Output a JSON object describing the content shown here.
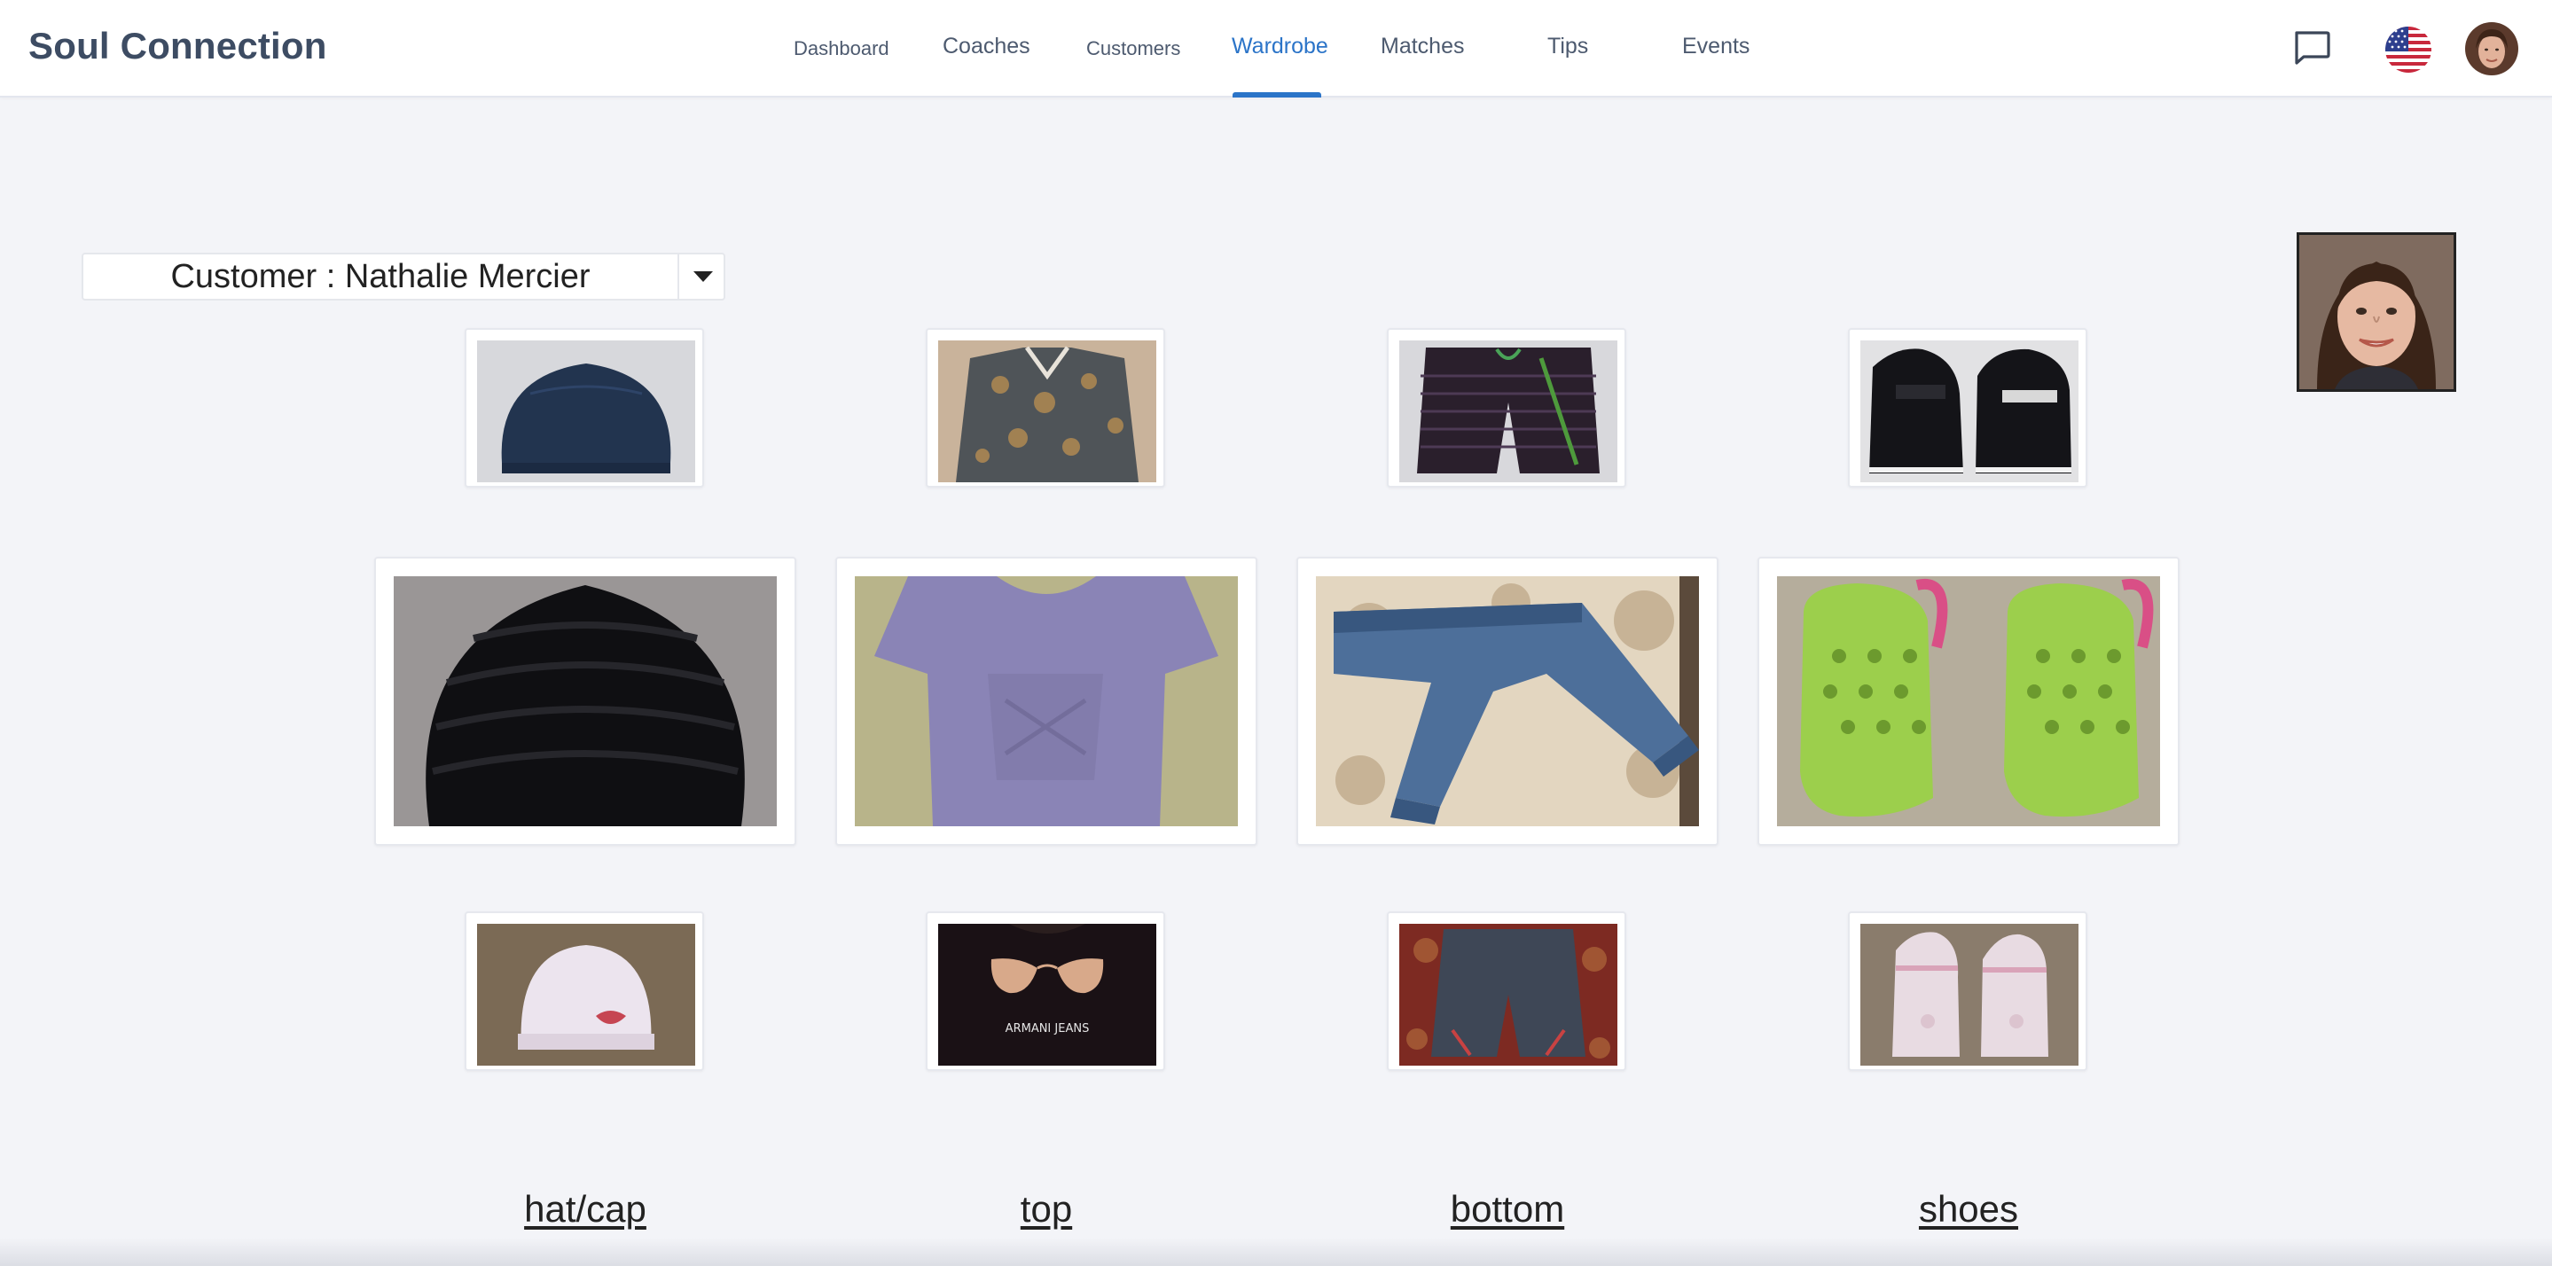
{
  "app": {
    "title": "Soul Connection"
  },
  "nav": {
    "dashboard": "Dashboard",
    "coaches": "Coaches",
    "customers": "Customers",
    "wardrobe": "Wardrobe",
    "matches": "Matches",
    "tips": "Tips",
    "events": "Events",
    "active": "Wardrobe",
    "accent_color": "#2b74c8"
  },
  "header_icons": {
    "messages": "chat-bubble-icon",
    "language": "us-flag-icon",
    "profile": "user-avatar"
  },
  "customer_select": {
    "label": "Customer : Nathalie Mercier",
    "caret": "caret-down-icon"
  },
  "wardrobe": {
    "columns": [
      {
        "category": "hat/cap",
        "items": [
          {
            "name": "navy beanie",
            "state": "preview"
          },
          {
            "name": "black knit beanie",
            "state": "selected"
          },
          {
            "name": "white beanie with red lips",
            "state": "preview"
          }
        ]
      },
      {
        "category": "top",
        "items": [
          {
            "name": "patterned blouse",
            "state": "preview"
          },
          {
            "name": "lavender t-shirt",
            "state": "selected"
          },
          {
            "name": "black ARMANI JEANS t-shirt",
            "state": "preview"
          }
        ]
      },
      {
        "category": "bottom",
        "items": [
          {
            "name": "striped board shorts",
            "state": "preview"
          },
          {
            "name": "blue denim joggers",
            "state": "selected"
          },
          {
            "name": "grey shorts",
            "state": "preview"
          }
        ]
      },
      {
        "category": "shoes",
        "items": [
          {
            "name": "black loafers",
            "state": "preview"
          },
          {
            "name": "green clogs",
            "state": "selected"
          },
          {
            "name": "pink mary-jane shoes",
            "state": "preview"
          }
        ]
      }
    ]
  },
  "shirt_print": "ARMANI JEANS"
}
